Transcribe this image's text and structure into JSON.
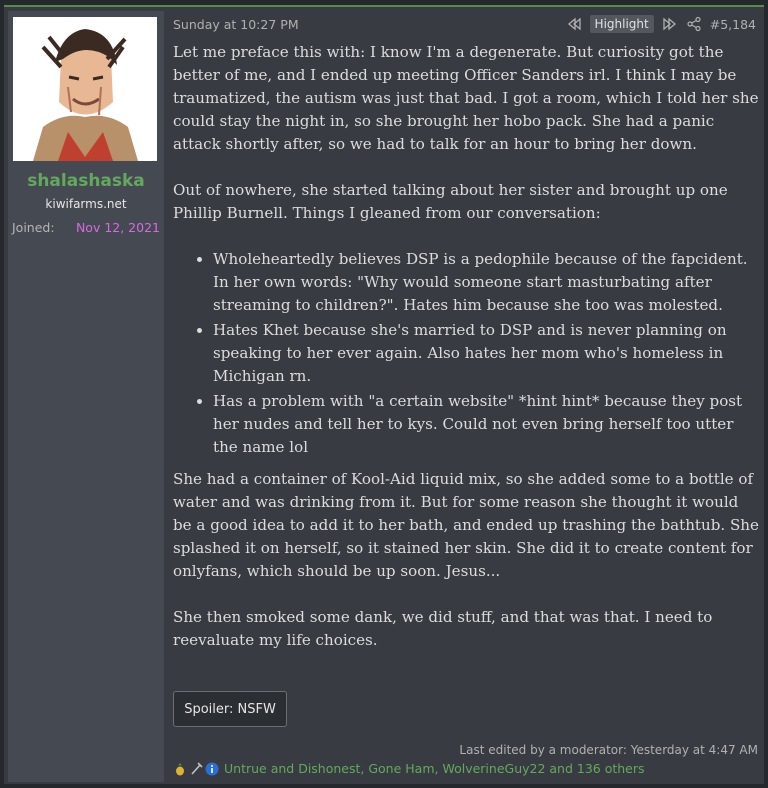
{
  "user": {
    "name": "shalashaska",
    "title": "kiwifarms.net",
    "joined_label": "Joined:",
    "joined_value": "Nov 12, 2021"
  },
  "post": {
    "timestamp": "Sunday at 10:27 PM",
    "highlight_label": "Highlight",
    "post_number": "#5,184",
    "paragraphs_top": [
      "Let me preface this with: I know I'm a degenerate. But curiosity got the better of me, and I ended up meeting Officer Sanders irl. I think I may be traumatized, the autism was just that bad. I got a room, which I told her she could stay the night in, so she brought her hobo pack. She had a panic attack shortly after, so we had to talk for an hour to bring her down.",
      "Out of nowhere, she started talking about her sister and brought up one Phillip Burnell. Things I gleaned from our conversation:"
    ],
    "bullets": [
      "Wholeheartedly believes DSP is a pedophile because of the fapcident. In her own words: \"Why would someone start masturbating after streaming to children?\". Hates him because she too was molested.",
      "Hates Khet because she's married to DSP and is never planning on speaking to her ever again. Also hates her mom who's homeless in Michigan rn.",
      "Has a problem with \"a certain website\" *hint hint* because they post her nudes and tell her to kys. Could not even bring herself too utter the name lol"
    ],
    "paragraphs_bottom": [
      "She had a container of Kool-Aid liquid mix, so she added some to a bottle of water and was drinking from it. But for some reason she thought it would be a good idea to add it to her bath, and ended up trashing the bathtub. She splashed it on herself, so it stained her skin. She did it to create content for onlyfans, which should be up soon. Jesus...",
      "She then smoked some dank, we did stuff, and that was that. I need to reevaluate my life choices."
    ],
    "spoiler_label": "Spoiler: NSFW",
    "edited_text": "Last edited by a moderator: Yesterday at 4:47 AM",
    "reaction_icons": [
      "pineapple-icon",
      "rake-icon",
      "info-icon"
    ],
    "reactions_text": "Untrue and Dishonest, Gone Ham, WolverineGuy22 and 136 others"
  },
  "colors": {
    "username": "#64a85e",
    "joined_value": "#d36be0",
    "reactions_link": "#64a85e"
  }
}
